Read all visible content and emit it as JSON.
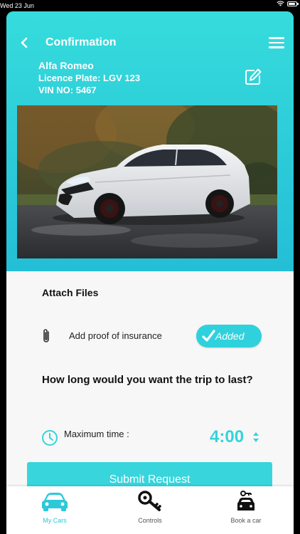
{
  "status_bar": {
    "time": "Wed 23 Jun"
  },
  "header": {
    "title": "Confirmation"
  },
  "car": {
    "name": "Alfa Romeo",
    "licence_plate": "Licence Plate: LGV 123",
    "vin": "VIN NO: 5467"
  },
  "attach": {
    "title": "Attach Files",
    "proof_label": "Add proof of insurance",
    "proof_status": "Added"
  },
  "trip": {
    "question": "How long would you want the trip to last?",
    "max_time_label": "Maximum time :",
    "max_time_value": "4:00"
  },
  "submit_label": "Submit Request",
  "tabs": [
    {
      "label": "My Cars",
      "active": true
    },
    {
      "label": "Controls",
      "active": false
    },
    {
      "label": "Book a car",
      "active": false
    }
  ],
  "colors": {
    "accent": "#36d3dc",
    "hero_top": "#36dcdc",
    "hero_bottom": "#24bed6"
  }
}
